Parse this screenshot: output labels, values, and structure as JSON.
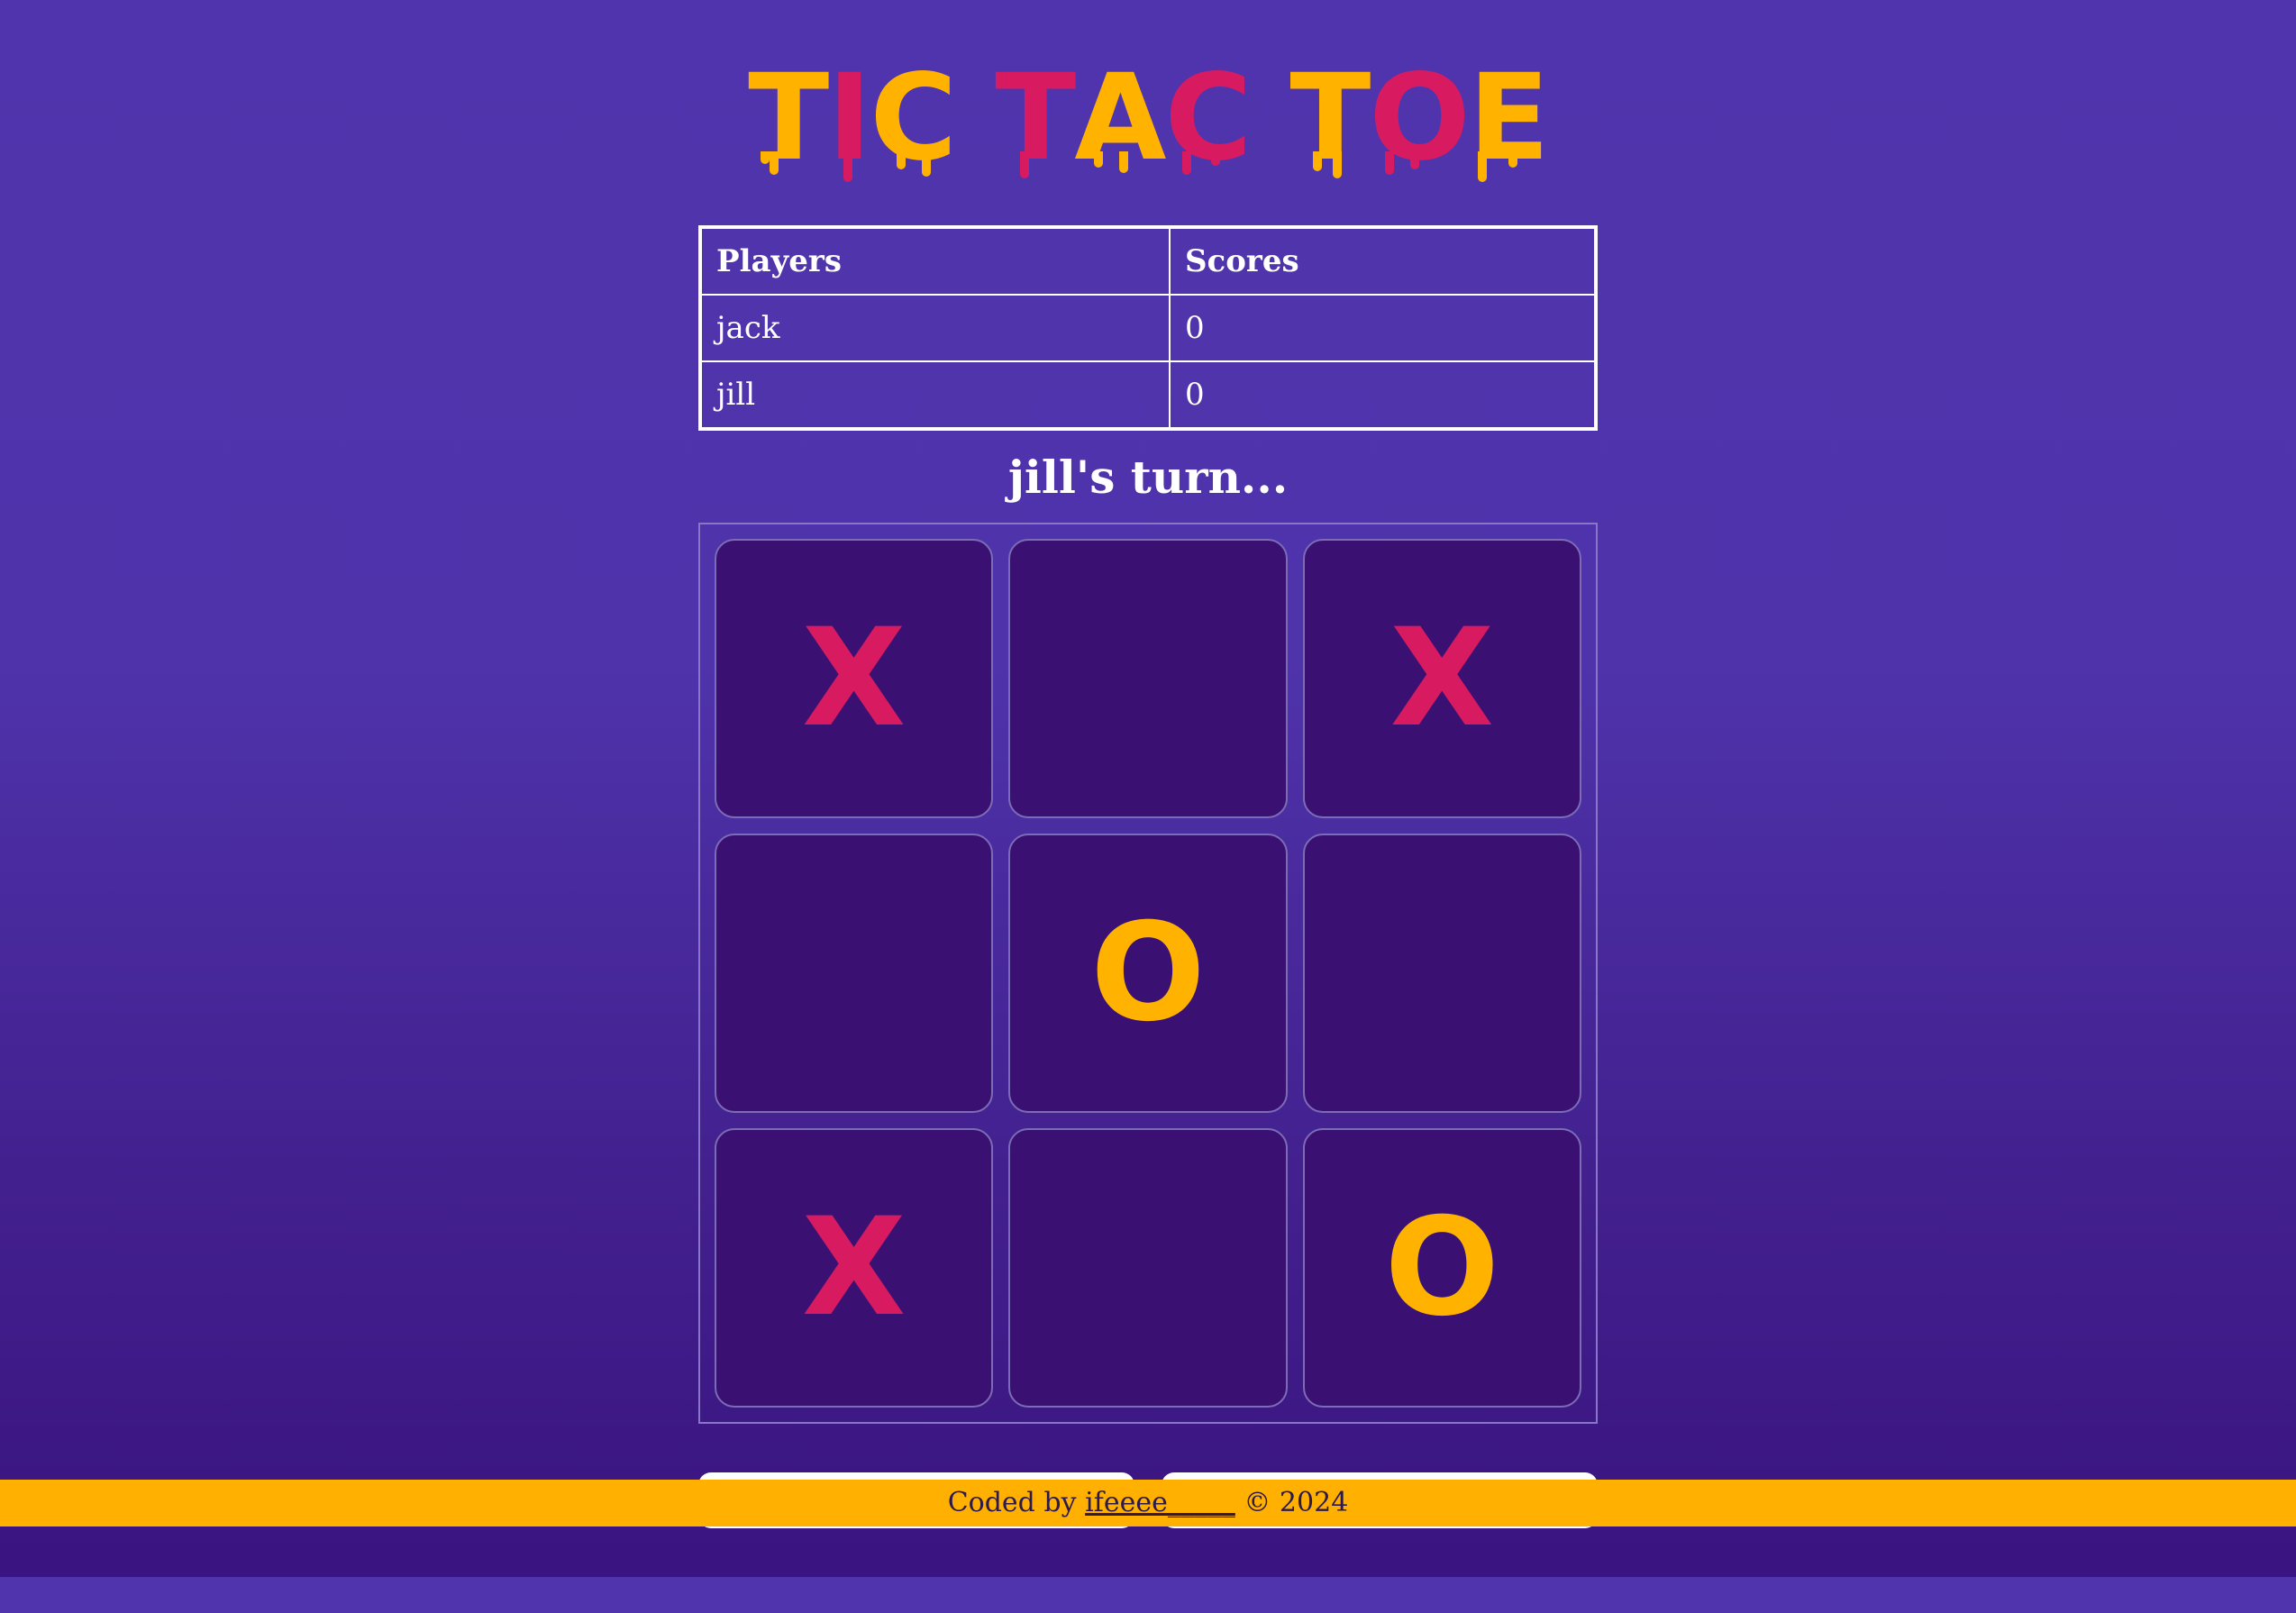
{
  "title": {
    "text": "TIC TAC TOE",
    "letters": [
      {
        "char": "T",
        "color": "#ffb300"
      },
      {
        "char": "I",
        "color": "#d81b60"
      },
      {
        "char": "C",
        "color": "#ffb300"
      },
      {
        "char": " ",
        "color": ""
      },
      {
        "char": "T",
        "color": "#d81b60"
      },
      {
        "char": "A",
        "color": "#ffb300"
      },
      {
        "char": "C",
        "color": "#d81b60"
      },
      {
        "char": " ",
        "color": ""
      },
      {
        "char": "T",
        "color": "#ffb300"
      },
      {
        "char": "O",
        "color": "#d81b60"
      },
      {
        "char": "E",
        "color": "#ffb300"
      }
    ]
  },
  "scoreboard": {
    "headers": {
      "players": "Players",
      "scores": "Scores"
    },
    "rows": [
      {
        "player": "jack",
        "score": "0"
      },
      {
        "player": "jill",
        "score": "0"
      }
    ]
  },
  "status": {
    "turn_text": "jill's turn..."
  },
  "board": {
    "cells": [
      "X",
      "",
      "X",
      "",
      "O",
      "",
      "X",
      "",
      "O"
    ],
    "colors": {
      "X": "#d81b60",
      "O": "#ffb300"
    }
  },
  "footer": {
    "prefix": "Coded by",
    "author": "ifeeee_____",
    "suffix": "© 2024"
  },
  "colors": {
    "background": "#5034ad",
    "cell": "#3a1173",
    "accent_yellow": "#ffb000",
    "accent_pink": "#d81b60"
  }
}
